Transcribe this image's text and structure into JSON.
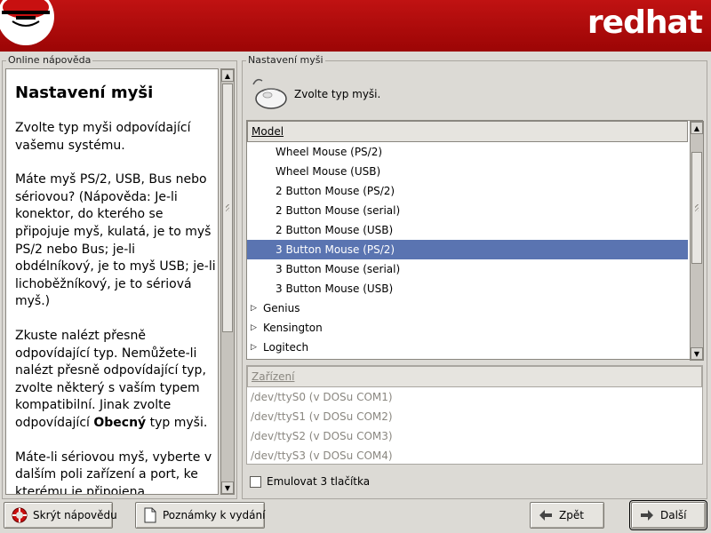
{
  "header": {
    "brand": "redhat"
  },
  "help_panel": {
    "frame_title": "Online nápověda",
    "heading": "Nastavení myši",
    "paragraphs": [
      "Zvolte typ myši odpovídající vašemu systému.",
      "Máte myš PS/2, USB, Bus nebo sériovou? (Nápověda: Je-li konektor, do kterého se připojuje myš, kulatá, je to myš PS/2 nebo Bus; je-li obdélníkový, je to myš USB; je-li lichoběžníkový, je to sériová myš.)",
      "Máte-li sériovou myš, vyberte v dalším poli zařízení a port, ke kterému je připojena."
    ],
    "p3_before": "Zkuste nalézt přesně odpovídající typ. Nemůžete-li nalézt přesně odpovídající typ, zvolte některý s vaším typem kompatibilní. Jinak zvolte odpovídající ",
    "p3_bold": "Obecný",
    "p3_after": " typ myši."
  },
  "mouse_panel": {
    "frame_title": "Nastavení myši",
    "prompt": "Zvolte typ myši.",
    "model_header": "Model",
    "models": [
      {
        "label": "Wheel Mouse (PS/2)",
        "kind": "child"
      },
      {
        "label": "Wheel Mouse (USB)",
        "kind": "child"
      },
      {
        "label": "2 Button Mouse (PS/2)",
        "kind": "child"
      },
      {
        "label": "2 Button Mouse (serial)",
        "kind": "child"
      },
      {
        "label": "2 Button Mouse (USB)",
        "kind": "child"
      },
      {
        "label": "3 Button Mouse (PS/2)",
        "kind": "child",
        "selected": true
      },
      {
        "label": "3 Button Mouse (serial)",
        "kind": "child"
      },
      {
        "label": "3 Button Mouse (USB)",
        "kind": "child"
      },
      {
        "label": "Genius",
        "kind": "parent"
      },
      {
        "label": "Kensington",
        "kind": "parent"
      },
      {
        "label": "Logitech",
        "kind": "parent"
      }
    ],
    "device_header": "Zařízení",
    "devices": [
      "/dev/ttyS0 (v DOSu COM1)",
      "/dev/ttyS1 (v DOSu COM2)",
      "/dev/ttyS2 (v DOSu COM3)",
      "/dev/ttyS3 (v DOSu COM4)"
    ],
    "emulate_label": "Emulovat 3 tlačítka",
    "emulate_checked": false
  },
  "buttons": {
    "hide_help": "Skrýt nápovědu",
    "release_notes": "Poznámky k vydání",
    "back": "Zpět",
    "next": "Další"
  },
  "colors": {
    "header_red": "#b00a0a",
    "selection_blue": "#5a74b1",
    "background": "#dcdad5"
  }
}
